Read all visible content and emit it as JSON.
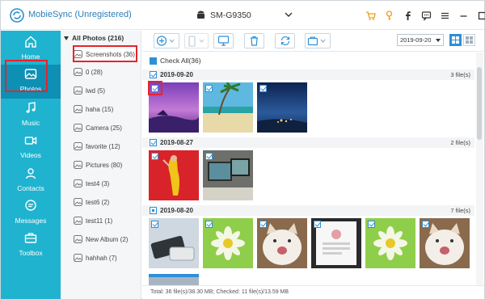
{
  "app": {
    "title": "MobieSync (Unregistered)",
    "device": "SM-G9350"
  },
  "titlebar_icons": [
    "cart-icon",
    "key-icon",
    "facebook-icon",
    "feedback-icon",
    "menu-icon",
    "minimize-icon",
    "maximize-icon",
    "close-icon"
  ],
  "sidebar": {
    "items": [
      {
        "label": "Home",
        "icon": "home-icon",
        "active": false
      },
      {
        "label": "Photos",
        "icon": "photos-icon",
        "active": true
      },
      {
        "label": "Music",
        "icon": "music-icon",
        "active": false
      },
      {
        "label": "Videos",
        "icon": "videos-icon",
        "active": false
      },
      {
        "label": "Contacts",
        "icon": "contacts-icon",
        "active": false
      },
      {
        "label": "Messages",
        "icon": "messages-icon",
        "active": false
      },
      {
        "label": "Toolbox",
        "icon": "toolbox-icon",
        "active": false
      }
    ]
  },
  "albums": {
    "header": "All Photos (216)",
    "items": [
      {
        "label": "Screenshots (36)",
        "selected": true
      },
      {
        "label": "0 (28)"
      },
      {
        "label": "lwd (5)"
      },
      {
        "label": "haha (15)"
      },
      {
        "label": "Camera (25)"
      },
      {
        "label": "favorite (12)"
      },
      {
        "label": "Pictures (80)"
      },
      {
        "label": "test4 (3)"
      },
      {
        "label": "test6 (2)"
      },
      {
        "label": "test11 (1)"
      },
      {
        "label": "New Album (2)"
      },
      {
        "label": "hahhah (7)"
      }
    ]
  },
  "toolbar": {
    "buttons": [
      "add-icon",
      "phone-export-icon",
      "pc-export-icon",
      "delete-icon",
      "refresh-icon",
      "toolbox-dropdown-icon"
    ],
    "date_filter": "2019-09-20"
  },
  "content": {
    "check_all": "Check All(36)",
    "groups": [
      {
        "date": "2019-09-20",
        "count": "3 file(s)",
        "state": "checked"
      },
      {
        "date": "2019-08-27",
        "count": "2 file(s)",
        "state": "checked"
      },
      {
        "date": "2019-08-20",
        "count": "7 file(s)",
        "state": "partial"
      }
    ]
  },
  "status": "Total: 36 file(s)/38.30 MB; Checked: 11 file(s)/13.59 MB",
  "colors": {
    "sidebar": "#1fb3cf",
    "sidebar_active": "#0e8fb4",
    "accent": "#2f8fd6",
    "highlight_box": "#e8232a"
  }
}
